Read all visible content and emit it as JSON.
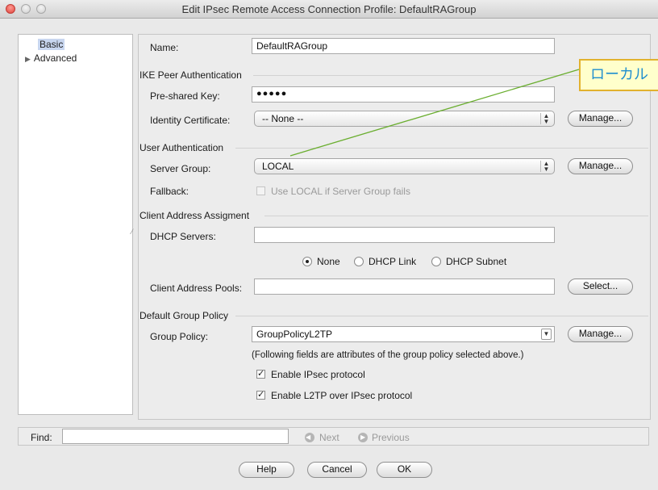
{
  "window": {
    "title": "Edit IPsec Remote Access Connection Profile: DefaultRAGroup"
  },
  "nav": {
    "items": [
      {
        "label": "Basic"
      },
      {
        "label": "Advanced"
      }
    ]
  },
  "form": {
    "name": {
      "label": "Name:",
      "value": "DefaultRAGroup"
    },
    "ike_section": "IKE Peer Authentication",
    "psk": {
      "label": "Pre-shared Key:",
      "value": "●●●●●"
    },
    "identity_cert": {
      "label": "Identity Certificate:",
      "value": "-- None --",
      "button": "Manage..."
    },
    "user_auth_section": "User Authentication",
    "server_group": {
      "label": "Server Group:",
      "value": "LOCAL",
      "button": "Manage..."
    },
    "fallback": {
      "label": "Fallback:",
      "checkbox_label": "Use LOCAL if Server Group fails",
      "checked": false
    },
    "client_addr_section": "Client Address Assigment",
    "dhcp_servers": {
      "label": "DHCP Servers:",
      "value": ""
    },
    "dhcp_mode": {
      "options": [
        "None",
        "DHCP Link",
        "DHCP Subnet"
      ],
      "selected": "None"
    },
    "client_pools": {
      "label": "Client Address Pools:",
      "value": "",
      "button": "Select..."
    },
    "default_group_policy_section": "Default Group Policy",
    "group_policy": {
      "label": "Group Policy:",
      "value": "GroupPolicyL2TP",
      "button": "Manage..."
    },
    "note": "(Following fields are attributes of the group policy selected above.)",
    "enable_ipsec": {
      "label": "Enable IPsec protocol",
      "checked": true
    },
    "enable_l2tp": {
      "label": "Enable L2TP over IPsec protocol",
      "checked": true
    }
  },
  "find": {
    "label": "Find:",
    "value": "",
    "next": "Next",
    "previous": "Previous"
  },
  "footer": {
    "help": "Help",
    "cancel": "Cancel",
    "ok": "OK"
  },
  "callout": {
    "text": "ローカル",
    "text_color": "#1e8ecf",
    "border_color": "#e2b22e",
    "line_color": "#6aae2f"
  },
  "icons": {
    "close": "close-icon",
    "minimize": "minimize-icon",
    "zoom": "zoom-icon",
    "expand": "disclosure-triangle-icon"
  }
}
